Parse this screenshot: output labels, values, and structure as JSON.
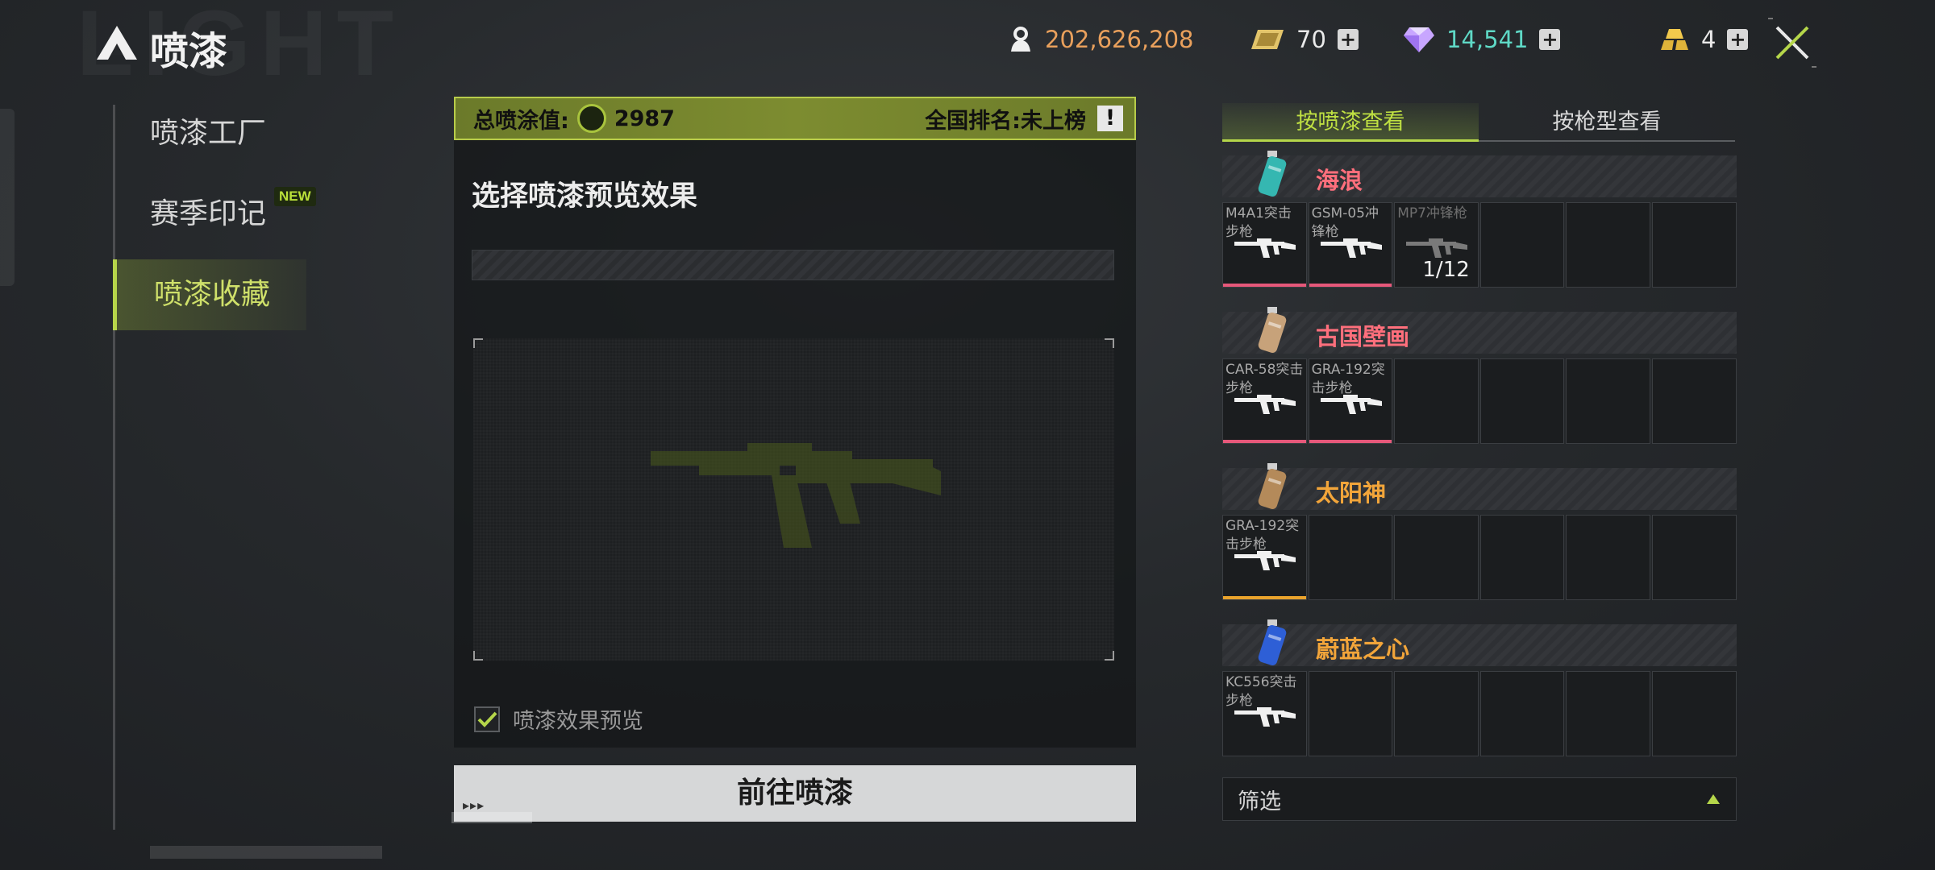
{
  "header": {
    "title": "喷漆",
    "watermark": "LIGHT",
    "close_icon": "close-icon",
    "currencies": [
      {
        "name": "coins",
        "icon": "coin-bag-icon",
        "value": "202,626,208",
        "color": "#e9a05c",
        "has_plus": false
      },
      {
        "name": "tickets",
        "icon": "ticket-icon",
        "value": "70",
        "color": "#eaeaea",
        "has_plus": true
      },
      {
        "name": "diamonds",
        "icon": "diamond-icon",
        "value": "14,541",
        "color": "#5fd9c6",
        "has_plus": true
      },
      {
        "name": "gold",
        "icon": "gold-bar-icon",
        "value": "4",
        "color": "#eaeaea",
        "has_plus": true
      }
    ]
  },
  "nav": {
    "items": [
      {
        "label": "喷漆工厂",
        "active": false
      },
      {
        "label": "赛季印记",
        "active": false,
        "badge": "NEW"
      },
      {
        "label": "喷漆收藏",
        "active": true
      }
    ]
  },
  "center": {
    "score_label": "总喷涂值:",
    "score_value": "2987",
    "rank_label": "全国排名:未上榜",
    "warn_symbol": "!",
    "select_title": "选择喷漆预览效果",
    "preview_checkbox_label": "喷漆效果预览",
    "preview_checked": true,
    "go_button": "前往喷漆",
    "go_dots": "▸▸▸"
  },
  "right": {
    "tabs": [
      {
        "label": "按喷漆查看",
        "active": true
      },
      {
        "label": "按枪型查看",
        "active": false
      }
    ],
    "groups": [
      {
        "name": "海浪",
        "name_color": "#ff6f7c",
        "can_color": "#35b7b1",
        "slots": [
          {
            "label": "M4A1突击步枪",
            "owned": true,
            "bar": "#e6587a"
          },
          {
            "label": "GSM-05冲锋枪",
            "owned": true,
            "bar": "#e6587a"
          },
          {
            "label": "MP7冲锋枪",
            "owned": false,
            "progress": "1/12"
          },
          {},
          {},
          {}
        ]
      },
      {
        "name": "古国壁画",
        "name_color": "#ff6f7c",
        "can_color": "#c7a27a",
        "slots": [
          {
            "label": "CAR-58突击步枪",
            "owned": true,
            "bar": "#e6587a"
          },
          {
            "label": "GRA-192突击步枪",
            "owned": true,
            "bar": "#e6587a"
          },
          {},
          {},
          {},
          {}
        ]
      },
      {
        "name": "太阳神",
        "name_color": "#f2a53a",
        "can_color": "#b48a5a",
        "slots": [
          {
            "label": "GRA-192突击步枪",
            "owned": true,
            "bar": "#eaa32c"
          },
          {},
          {},
          {},
          {},
          {}
        ]
      },
      {
        "name": "蔚蓝之心",
        "name_color": "#f2a53a",
        "can_color": "#2e5fd6",
        "slots": [
          {
            "label": "KC556突击步枪",
            "owned": true
          },
          {},
          {},
          {},
          {},
          {}
        ]
      }
    ],
    "filter_label": "筛选"
  }
}
